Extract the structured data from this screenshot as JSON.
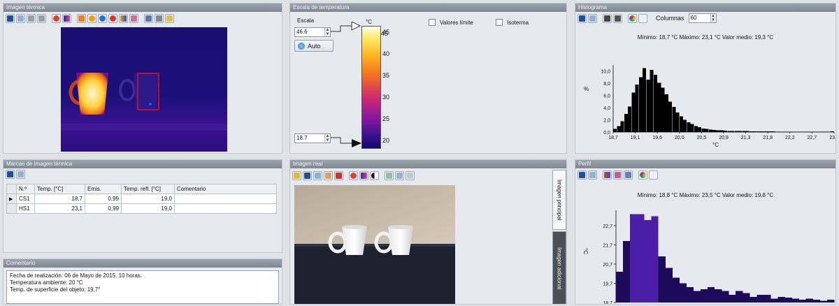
{
  "thermal_panel": {
    "title": "Imagen térmica"
  },
  "scale_panel": {
    "title": "Escala de temperatura",
    "scale_label": "Escala",
    "max_value": "46.6",
    "auto_label": "Auto",
    "unit": "°C",
    "ticks": [
      "45",
      "40",
      "35",
      "30",
      "25",
      "20"
    ],
    "min_value": "18.7",
    "limit_values_label": "Valores límite",
    "isotherm_label": "Isoterma"
  },
  "histogram_panel": {
    "title": "Histograma",
    "columns_label": "Columnas",
    "columns_value": "60",
    "stats": "Mínimo: 18,7 °C Máximo: 23,1 °C Valor medio: 19,3 °C",
    "ylabel": "%",
    "xlabel": "°C",
    "bar_color": "#000000"
  },
  "markers_panel": {
    "title": "Marcas de imagen térmica",
    "columns": [
      "N.º",
      "Temp. [°C]",
      "Emis.",
      "Temp. refl. [°C]",
      "Comentario"
    ],
    "rows": [
      {
        "name": "CS1",
        "temp": "18,7",
        "emis": "0,99",
        "refl": "19,0",
        "comment": ""
      },
      {
        "name": "HS1",
        "temp": "23,1",
        "emis": "0,99",
        "refl": "19,0",
        "comment": ""
      }
    ]
  },
  "comment_panel": {
    "title": "Comentario",
    "lines": [
      "Fecha de realización: 06 de Mayo de 2015. 10 horas.",
      "Temperatura ambiente: 20 °C",
      "Temp. de superficie del objeto: 19,7°"
    ]
  },
  "real_panel": {
    "title": "Imagen real",
    "tab_main": "Imagen principal",
    "tab_extra": "Imagen adicional"
  },
  "profile_panel": {
    "title": "Perfil",
    "stats": "Mínimo: 18,8 °C Máximo: 23,5 °C Valor medio: 19,8 °C",
    "ylabel": "°C",
    "bar_color": "#1e0a5a",
    "peak_color": "#4b1ea8"
  },
  "chart_data": [
    {
      "type": "bar",
      "title": "",
      "xlabel": "°C",
      "ylabel": "%",
      "x_ticks": [
        "18,7",
        "19,1",
        "19,6",
        "20,0",
        "20,5",
        "20,9",
        "21,3",
        "21,8",
        "22,2",
        "22,7",
        "23,1"
      ],
      "y_ticks": [
        "0,0",
        "2,0",
        "4,0",
        "6,0",
        "8,0",
        "10,0"
      ],
      "xlim": [
        18.7,
        23.1
      ],
      "ylim": [
        0,
        11
      ],
      "values": [
        0.5,
        1.0,
        1.8,
        3.0,
        4.2,
        6.5,
        7.8,
        9.0,
        10.5,
        8.6,
        10.2,
        9.4,
        8.1,
        7.3,
        6.2,
        5.0,
        4.1,
        3.2,
        2.6,
        2.0,
        1.6,
        1.3,
        1.0,
        0.8,
        0.6,
        0.5,
        0.4,
        0.35,
        0.3,
        0.3,
        0.25,
        0.2,
        0.2,
        0.2,
        0.15,
        0.15,
        0.15,
        0.1,
        0.1,
        0.1,
        0.1,
        0.1,
        0.1,
        0.1,
        0.08,
        0.08,
        0.08,
        0.08,
        0.08,
        0.08,
        0.08,
        0.08,
        0.08,
        0.08,
        0.08,
        0.08,
        0.08,
        0.08,
        0.08,
        0.1
      ]
    },
    {
      "type": "bar",
      "title": "",
      "xlabel": "",
      "ylabel": "°C",
      "y_ticks": [
        "18,7",
        "19,7",
        "20,7",
        "21,7",
        "22,7"
      ],
      "ylim": [
        18.7,
        23.5
      ],
      "values": [
        20.3,
        21.9,
        23.3,
        23.3,
        23.0,
        23.2,
        21.1,
        20.5,
        20.0,
        19.7,
        19.5,
        19.3,
        19.4,
        19.5,
        19.4,
        19.3,
        19.1,
        19.3,
        19.2,
        19.0,
        19.1,
        19.1,
        18.9,
        19.0,
        18.95,
        18.9,
        18.85,
        18.9,
        18.85,
        18.8,
        18.85
      ]
    }
  ]
}
